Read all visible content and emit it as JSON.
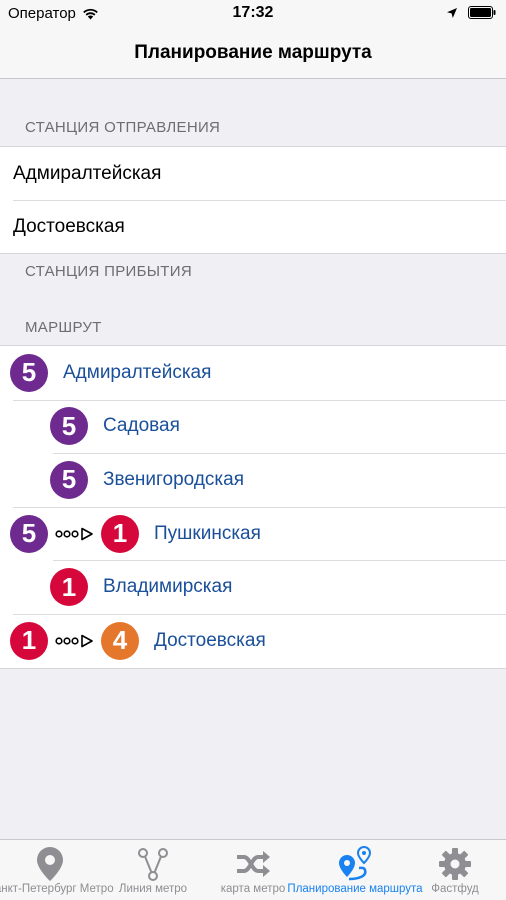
{
  "status_bar": {
    "carrier": "Оператор",
    "time": "17:32"
  },
  "nav": {
    "title": "Планирование маршрута"
  },
  "departure": {
    "header": "СТАНЦИЯ ОТПРАВЛЕНИЯ",
    "from": "Адмиралтейская",
    "to": "Достоевская"
  },
  "arrival": {
    "header": "СТАНЦИЯ ПРИБЫТИЯ"
  },
  "route": {
    "header": "МАРШРУТ",
    "steps": [
      {
        "station": "Адмиралтейская",
        "line": "5",
        "line_color": "#6e2a8f"
      },
      {
        "station": "Садовая",
        "line": "5",
        "line_color": "#6e2a8f"
      },
      {
        "station": "Звенигородская",
        "line": "5",
        "line_color": "#6e2a8f"
      },
      {
        "station": "Пушкинская",
        "from_line": "5",
        "from_color": "#6e2a8f",
        "line": "1",
        "line_color": "#d6083b"
      },
      {
        "station": "Владимирская",
        "line": "1",
        "line_color": "#d6083b"
      },
      {
        "station": "Достоевская",
        "from_line": "1",
        "from_color": "#d6083b",
        "line": "4",
        "line_color": "#e4772b"
      }
    ]
  },
  "tabs": [
    {
      "label": "Санкт-Петербург Метро",
      "icon": "map-pin-icon"
    },
    {
      "label": "Линия метро",
      "icon": "metro-logo-icon"
    },
    {
      "label": "карта метро",
      "icon": "shuffle-icon"
    },
    {
      "label": "Планирование маршрута",
      "icon": "route-planning-icon",
      "active": true
    },
    {
      "label": "Фастфуд",
      "icon": "gear-icon"
    }
  ],
  "colors": {
    "accent": "#1a82f0",
    "line5": "#6e2a8f",
    "line1": "#d6083b",
    "line4": "#e4772b"
  }
}
